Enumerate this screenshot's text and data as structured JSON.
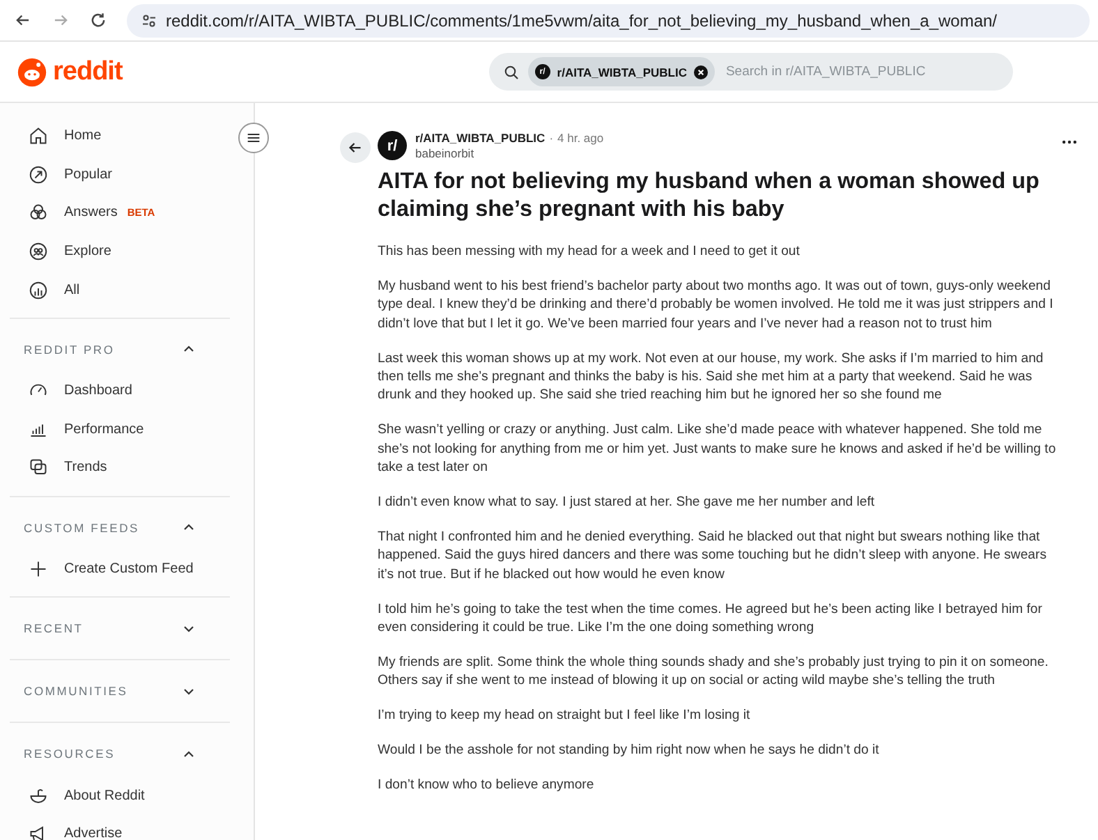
{
  "browser": {
    "url": "reddit.com/r/AITA_WIBTA_PUBLIC/comments/1me5vwm/aita_for_not_believing_my_husband_when_a_woman/"
  },
  "header": {
    "logo": "reddit",
    "search": {
      "community_chip": "r/AITA_WIBTA_PUBLIC",
      "chip_icon": "r/",
      "placeholder": "Search in r/AITA_WIBTA_PUBLIC"
    }
  },
  "sidebar": {
    "items": [
      {
        "label": "Home"
      },
      {
        "label": "Popular"
      },
      {
        "label": "Answers",
        "badge": "BETA"
      },
      {
        "label": "Explore"
      },
      {
        "label": "All"
      }
    ],
    "sections": [
      {
        "title": "REDDIT PRO",
        "expanded": true,
        "items": [
          {
            "label": "Dashboard"
          },
          {
            "label": "Performance"
          },
          {
            "label": "Trends"
          }
        ]
      },
      {
        "title": "CUSTOM FEEDS",
        "expanded": true,
        "items": [
          {
            "label": "Create Custom Feed"
          }
        ]
      },
      {
        "title": "RECENT",
        "expanded": false
      },
      {
        "title": "COMMUNITIES",
        "expanded": false
      },
      {
        "title": "RESOURCES",
        "expanded": true,
        "items": [
          {
            "label": "About Reddit"
          },
          {
            "label": "Advertise"
          }
        ]
      }
    ]
  },
  "post": {
    "avatar": "r/",
    "community": "r/AITA_WIBTA_PUBLIC",
    "separator": "·",
    "time": "4 hr. ago",
    "author": "babeinorbit",
    "title": "AITA for not believing my husband when a woman showed up claiming she’s pregnant with his baby",
    "paragraphs": [
      "This has been messing with my head for a week and I need to get it out",
      "My husband went to his best friend’s bachelor party about two months ago. It was out of town, guys-only weekend type deal. I knew they’d be drinking and there’d probably be women involved. He told me it was just strippers and I didn’t love that but I let it go. We’ve been married four years and I’ve never had a reason not to trust him",
      "Last week this woman shows up at my work. Not even at our house, my work. She asks if I’m married to him and then tells me she’s pregnant and thinks the baby is his. Said she met him at a party that weekend. Said he was drunk and they hooked up. She said she tried reaching him but he ignored her so she found me",
      "She wasn’t yelling or crazy or anything. Just calm. Like she’d made peace with whatever happened. She told me she’s not looking for anything from me or him yet. Just wants to make sure he knows and asked if he’d be willing to take a test later on",
      "I didn’t even know what to say. I just stared at her. She gave me her number and left",
      "That night I confronted him and he denied everything. Said he blacked out that night but swears nothing like that happened. Said the guys hired dancers and there was some touching but he didn’t sleep with anyone. He swears it’s not true. But if he blacked out how would he even know",
      "I told him he’s going to take the test when the time comes. He agreed but he’s been acting like I betrayed him for even considering it could be true. Like I’m the one doing something wrong",
      "My friends are split. Some think the whole thing sounds shady and she’s probably just trying to pin it on someone. Others say if she went to me instead of blowing it up on social or acting wild maybe she’s telling the truth",
      "I’m trying to keep my head on straight but I feel like I’m losing it",
      "Would I be the asshole for not standing by him right now when he says he didn’t do it",
      "I don’t know who to believe anymore"
    ]
  }
}
